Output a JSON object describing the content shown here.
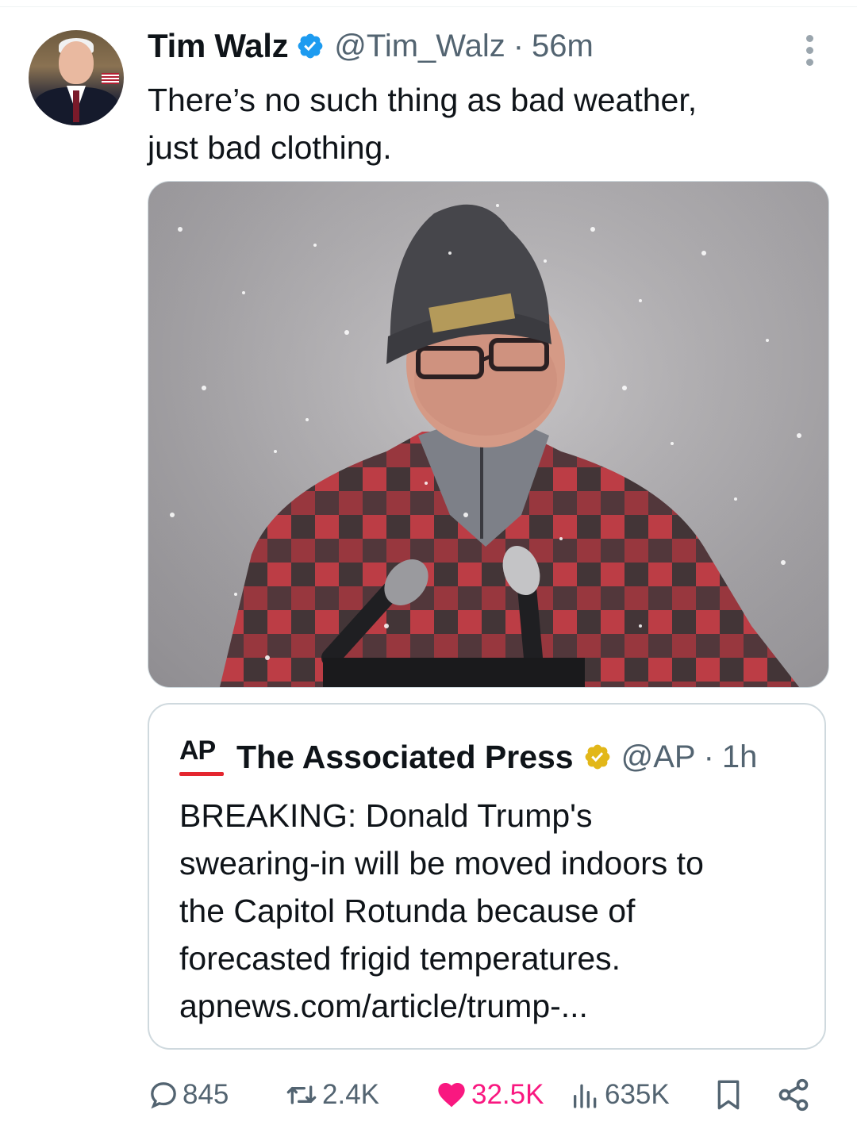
{
  "tweet": {
    "author_name": "Tim Walz",
    "handle": "@Tim_Walz",
    "separator": "·",
    "time": "56m",
    "text_line1": "There’s no such thing as bad weather,",
    "text_line2": "just bad clothing."
  },
  "quote": {
    "logo_text": "AP",
    "author_name": "The Associated Press",
    "handle": "@AP",
    "separator": "·",
    "time": "1h",
    "lines": [
      "BREAKING: Donald Trump's",
      "swearing-in will be moved indoors to",
      "the Capitol Rotunda because of",
      "forecasted frigid temperatures.",
      "apnews.com/article/trump-..."
    ]
  },
  "actions": {
    "replies": "845",
    "reposts": "2.4K",
    "likes": "32.5K",
    "views": "635K"
  },
  "colors": {
    "verified_blue": "#1d9bf0",
    "verified_gold": "#e2b719",
    "like_pink": "#f91880",
    "secondary_text": "#536471",
    "border": "#cfd9de"
  },
  "icons": [
    "verified-badge-icon",
    "more-options-icon",
    "reply-icon",
    "repost-icon",
    "like-icon",
    "views-icon",
    "bookmark-icon",
    "share-icon"
  ]
}
